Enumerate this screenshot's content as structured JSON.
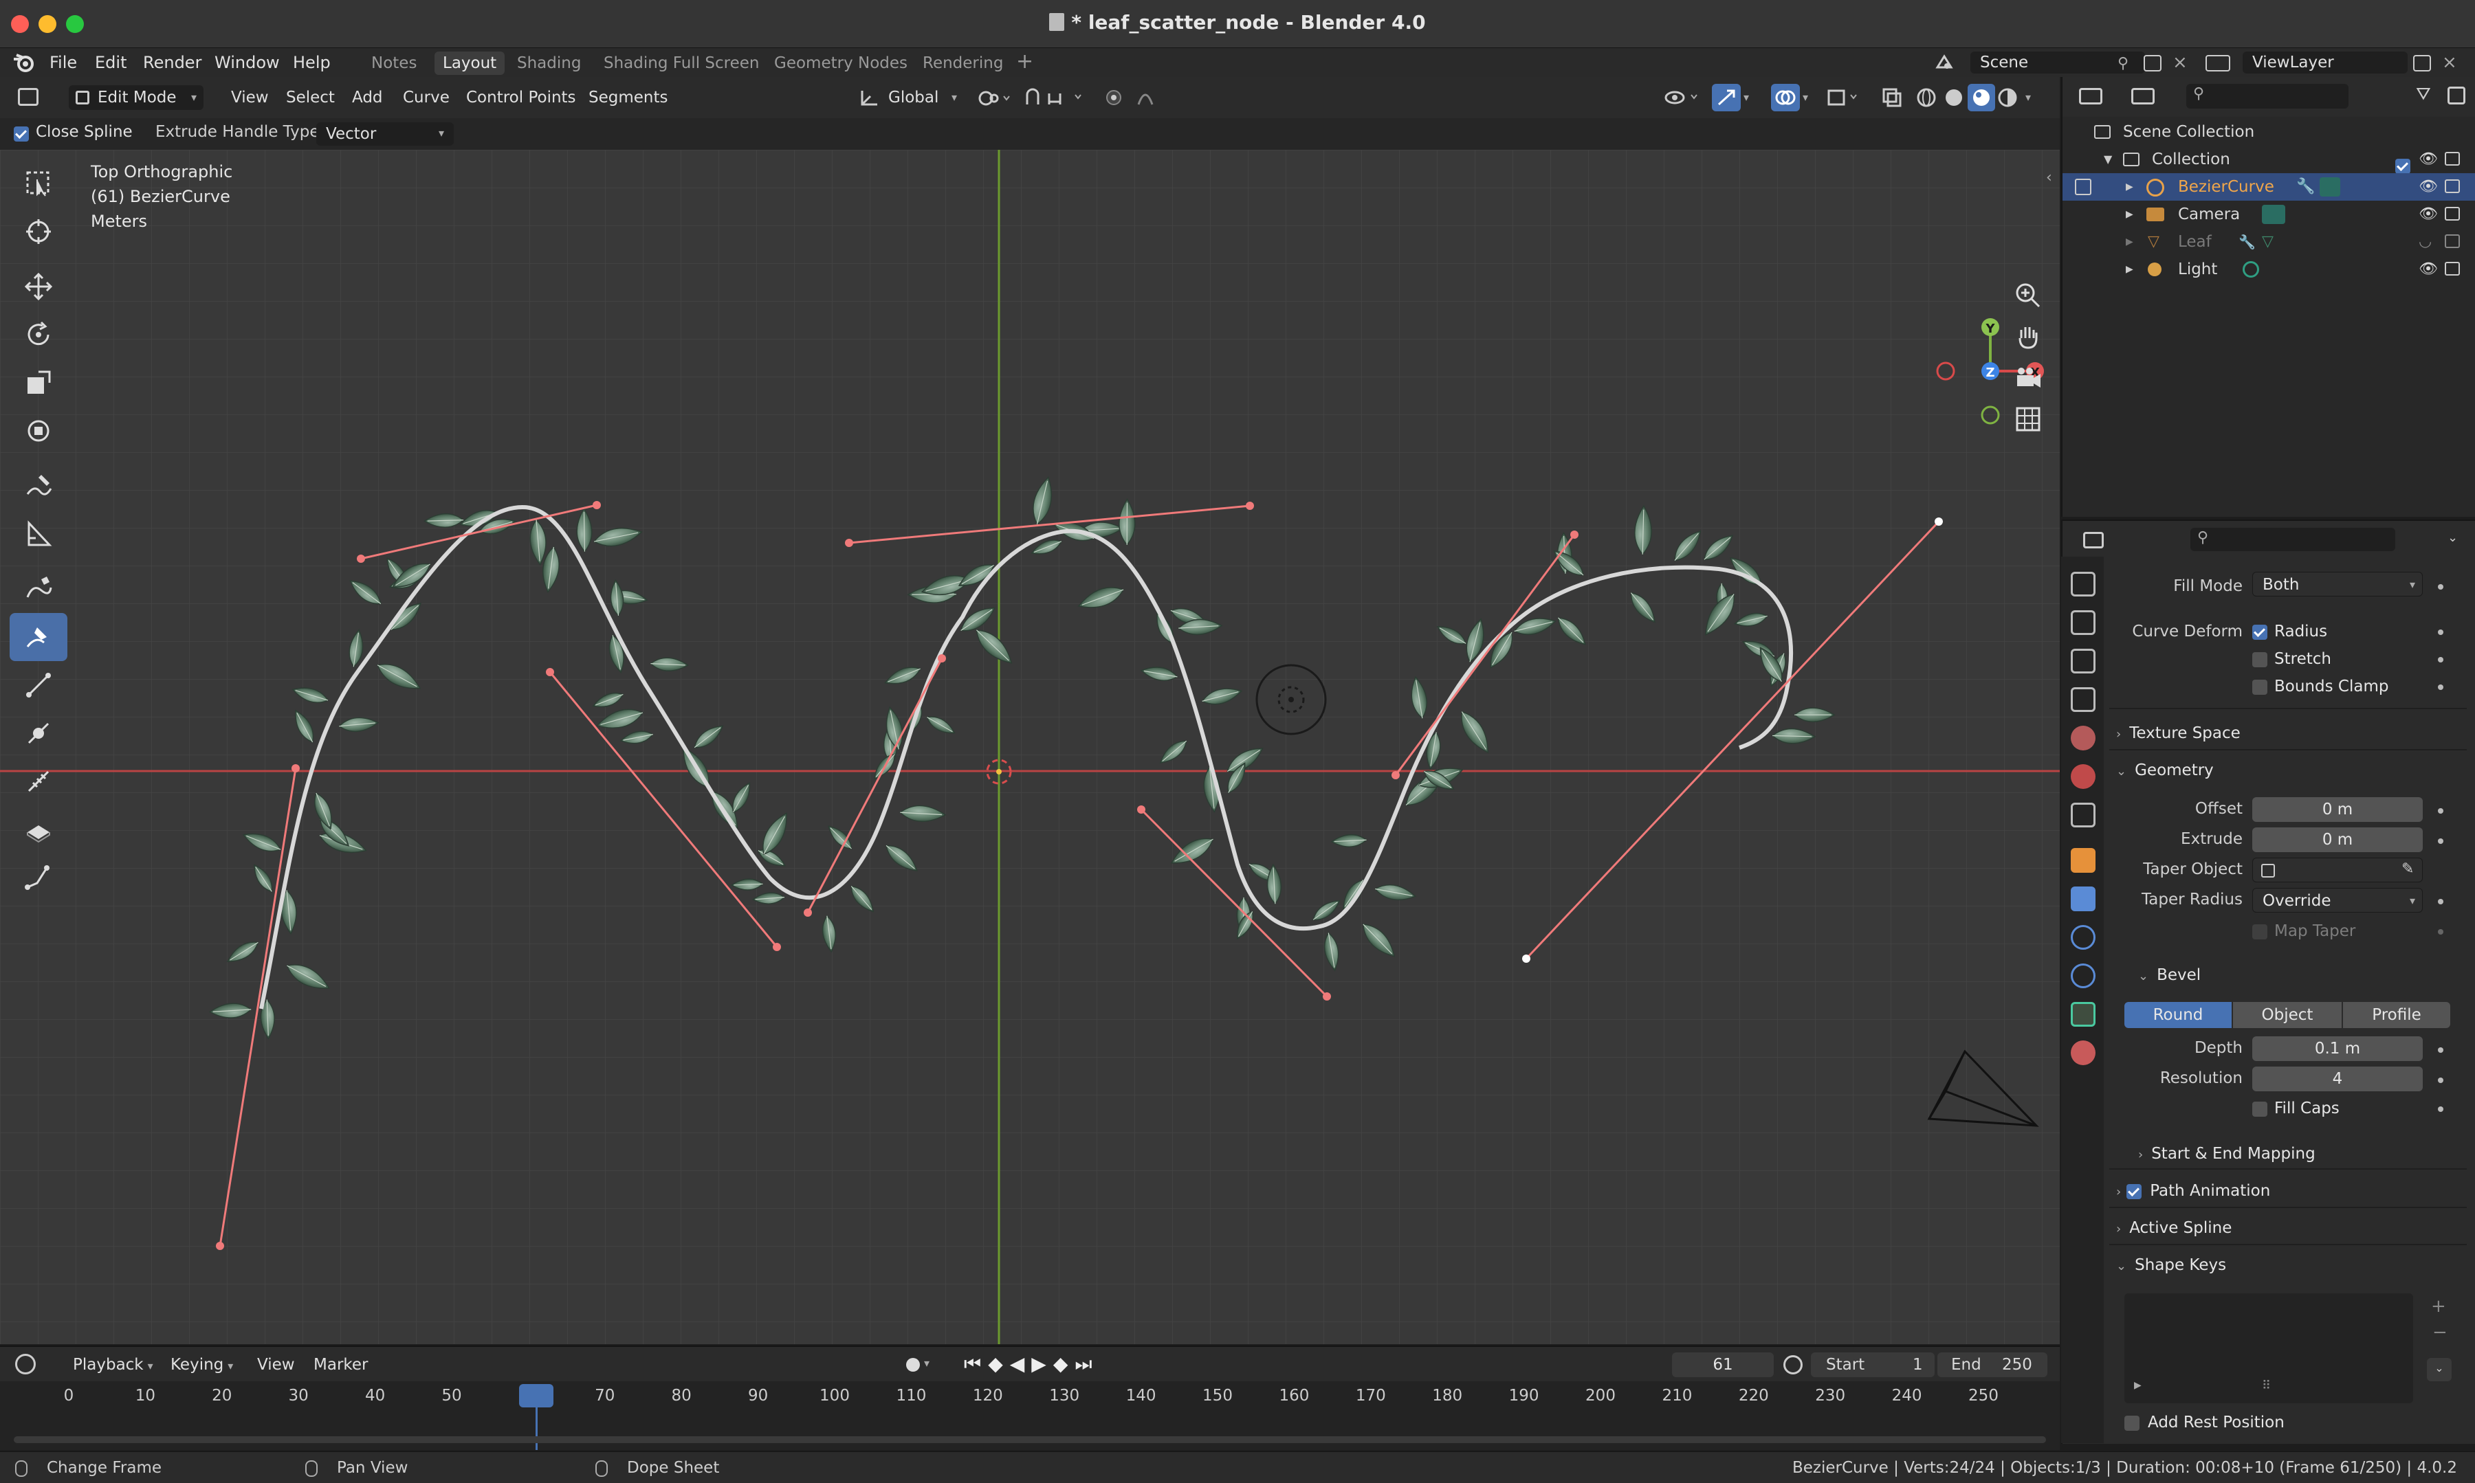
{
  "window": {
    "title": "* leaf_scatter_node - Blender 4.0",
    "traffic_colors": [
      "#fe5f57",
      "#febc2e",
      "#28c840"
    ]
  },
  "menu": [
    "File",
    "Edit",
    "Render",
    "Window",
    "Help"
  ],
  "workspaces": [
    "Notes",
    "Layout",
    "Shading",
    "Shading Full Screen",
    "Geometry Nodes",
    "Rendering"
  ],
  "active_workspace": "Layout",
  "scene": {
    "scene_name": "Scene",
    "view_layer": "ViewLayer"
  },
  "viewport_header": {
    "mode": "Edit Mode",
    "menus": [
      "View",
      "Select",
      "Add",
      "Curve",
      "Control Points",
      "Segments"
    ],
    "transform_orientation": "Global",
    "close_spline_label": "Close Spline",
    "extrude_label": "Extrude Handle Type:",
    "extrude_value": "Vector"
  },
  "viewport_overlay": {
    "view_name": "Top Orthographic",
    "object_line": "(61) BezierCurve",
    "units": "Meters"
  },
  "gizmo": {
    "y": "Y",
    "z": "Z",
    "x": "X"
  },
  "outliner": {
    "root": "Scene Collection",
    "collection": "Collection",
    "items": [
      {
        "name": "BezierCurve",
        "selected": true
      },
      {
        "name": "Camera",
        "selected": false
      },
      {
        "name": "Leaf",
        "selected": false,
        "hidden": true
      },
      {
        "name": "Light",
        "selected": false
      }
    ]
  },
  "properties": {
    "fill_mode_label": "Fill Mode",
    "fill_mode_value": "Both",
    "curve_deform_label": "Curve Deform",
    "radius_label": "Radius",
    "stretch_label": "Stretch",
    "bounds_clamp_label": "Bounds Clamp",
    "texture_space": "Texture Space",
    "geometry": "Geometry",
    "offset_label": "Offset",
    "offset_value": "0 m",
    "extrude_label": "Extrude",
    "extrude_value": "0 m",
    "taper_object_label": "Taper Object",
    "taper_radius_label": "Taper Radius",
    "taper_radius_value": "Override",
    "map_taper_label": "Map Taper",
    "bevel": "Bevel",
    "bevel_modes": [
      "Round",
      "Object",
      "Profile"
    ],
    "depth_label": "Depth",
    "depth_value": "0.1 m",
    "resolution_label": "Resolution",
    "resolution_value": "4",
    "fill_caps_label": "Fill Caps",
    "start_end_mapping": "Start & End Mapping",
    "path_animation": "Path Animation",
    "active_spline": "Active Spline",
    "shape_keys": "Shape Keys",
    "add_rest_position": "Add Rest Position"
  },
  "timeline": {
    "menus": [
      "Playback",
      "Keying",
      "View",
      "Marker"
    ],
    "current_frame": "61",
    "start_label": "Start",
    "start_value": "1",
    "end_label": "End",
    "end_value": "250",
    "ticks": [
      "0",
      "10",
      "20",
      "30",
      "40",
      "50",
      "61",
      "70",
      "80",
      "90",
      "100",
      "110",
      "120",
      "130",
      "140",
      "150",
      "160",
      "170",
      "180",
      "190",
      "200",
      "210",
      "220",
      "230",
      "240",
      "250"
    ]
  },
  "status": {
    "change_frame": "Change Frame",
    "pan_view": "Pan View",
    "dope_sheet": "Dope Sheet",
    "info": "BezierCurve | Verts:24/24 | Objects:1/3 | Duration: 00:08+10 (Frame 61/250) | 4.0.2"
  },
  "colors": {
    "accent": "#4772b3",
    "handle": "#f07a7a",
    "x_axis": "#c94848",
    "y_axis": "#7ba23c"
  }
}
